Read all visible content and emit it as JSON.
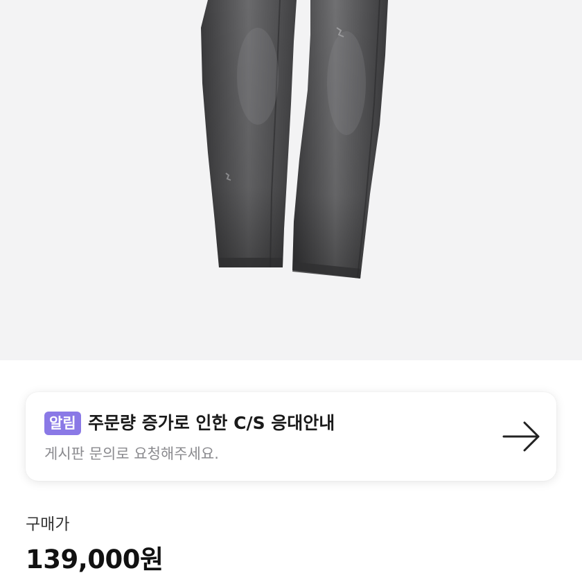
{
  "product": {
    "image_icon": "jeans-photo"
  },
  "notice": {
    "badge": "알림",
    "title": "주문량 증가로 인한 C/S 응대안내",
    "subtitle": "게시판 문의로 요청해주세요.",
    "arrow_icon": "arrow-right-icon",
    "badge_color": "#8a79e6"
  },
  "price": {
    "label": "구매가",
    "value": "139,000원"
  }
}
